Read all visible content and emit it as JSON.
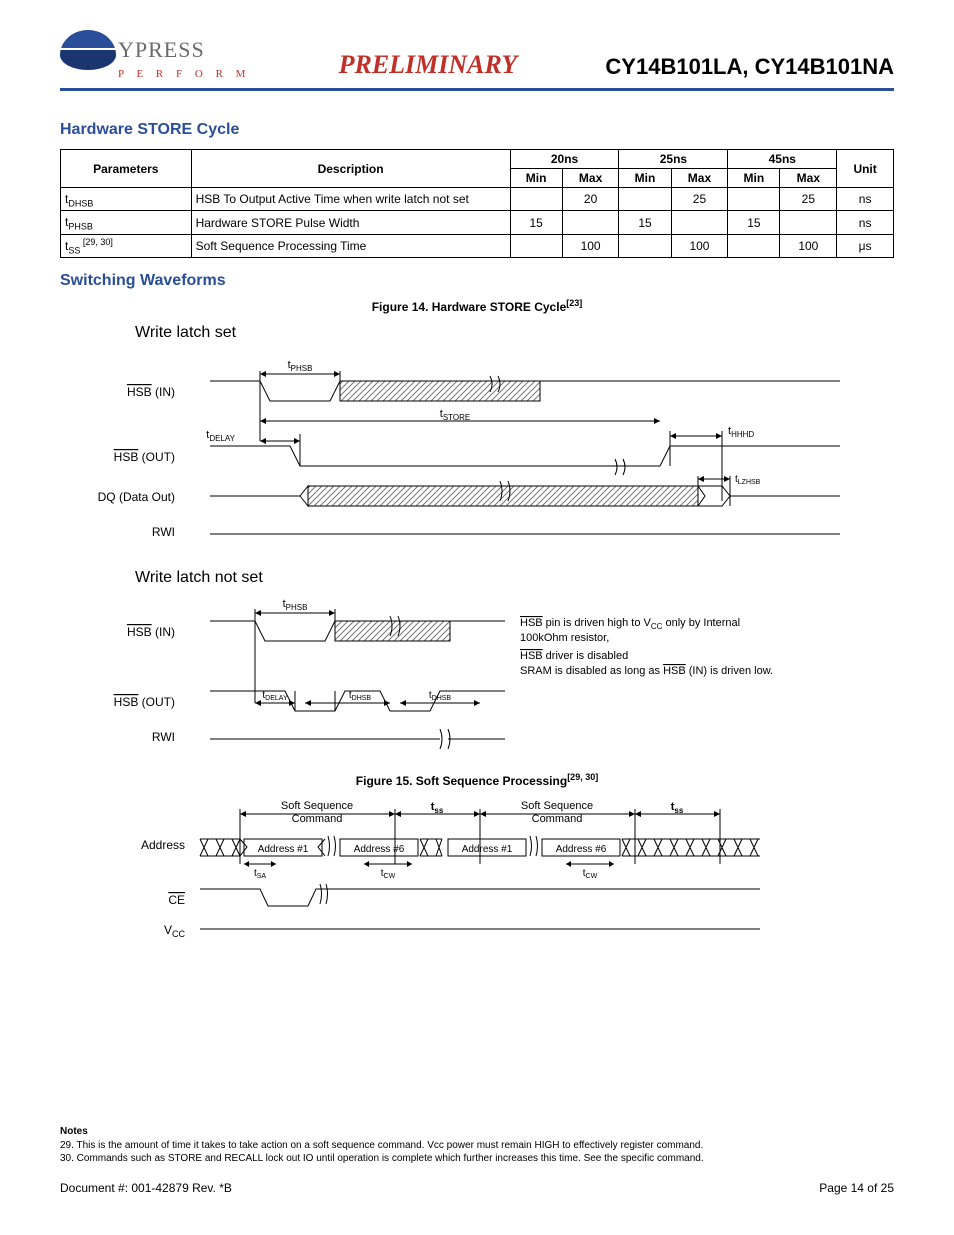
{
  "header": {
    "brand": "YPRESS",
    "tagline": "P E R F O R M",
    "preliminary": "PRELIMINARY",
    "parts": "CY14B101LA, CY14B101NA"
  },
  "section1_title": "Hardware STORE Cycle",
  "table": {
    "headers": {
      "parameters": "Parameters",
      "description": "Description",
      "cols": [
        "20ns",
        "25ns",
        "45ns"
      ],
      "min": "Min",
      "max": "Max",
      "unit": "Unit"
    },
    "rows": [
      {
        "param_main": "t",
        "param_sub": "DHSB",
        "param_sup": "",
        "desc": "HSB To Output Active Time when write latch not set",
        "c20min": "",
        "c20max": "20",
        "c25min": "",
        "c25max": "25",
        "c45min": "",
        "c45max": "25",
        "unit": "ns"
      },
      {
        "param_main": "t",
        "param_sub": "PHSB",
        "param_sup": "",
        "desc": "Hardware STORE Pulse Width",
        "c20min": "15",
        "c20max": "",
        "c25min": "15",
        "c25max": "",
        "c45min": "15",
        "c45max": "",
        "unit": "ns"
      },
      {
        "param_main": "t",
        "param_sub": "SS",
        "param_sup": " [29, 30]",
        "desc": "Soft Sequence Processing Time",
        "c20min": "",
        "c20max": "100",
        "c25min": "",
        "c25max": "100",
        "c45min": "",
        "c45max": "100",
        "unit": "μs"
      }
    ]
  },
  "section2_title": "Switching Waveforms",
  "fig14": {
    "caption_main": "Figure 14.  Hardware STORE Cycle",
    "caption_sup": "[23]",
    "title1": "Write latch set",
    "title2": "Write latch not set",
    "sig_hsb_in": "HSB",
    "sig_in_suffix": "  (IN)",
    "sig_hsb_out": "HSB",
    "sig_out_suffix": "  (OUT)",
    "sig_dq": "DQ (Data Out)",
    "sig_rwi": "RWI",
    "t_phsb": "PHSB",
    "t_store": "STORE",
    "t_delay": "DELAY",
    "t_hhhd": "HHHD",
    "t_lzhsb": "LZHSB",
    "t_dhsb": "DHSB",
    "note_l1a": "HSB",
    "note_l1b": " pin is driven high to V",
    "note_l1c": "CC",
    "note_l1d": " only by Internal",
    "note_l2": "100kOhm resistor,",
    "note_l3a": "HSB",
    "note_l3b": " driver is disabled",
    "note_l4a": "SRAM is disabled as long as ",
    "note_l4b": "HSB",
    "note_l4c": " (IN) is driven low."
  },
  "fig15": {
    "caption_main": "Figure 15.  Soft Sequence Processing",
    "caption_sup": "[29, 30]",
    "sig_address": "Address",
    "sig_ce": "CE",
    "sig_vcc_a": "V",
    "sig_vcc_b": "CC",
    "soft_seq": "Soft Sequence",
    "command": "Command",
    "t_ss": "ss",
    "t_sa": "SA",
    "t_cw": "CW",
    "addr1": "Address #1",
    "addr6": "Address #6"
  },
  "notes": {
    "heading": "Notes",
    "n29": "29. This is the amount of time it takes to take action on a soft sequence command. Vcc power must remain HIGH to effectively register command.",
    "n30": "30. Commands such as STORE and RECALL lock out IO until operation is complete which further increases this time. See the specific command."
  },
  "footer": {
    "docnum": "Document #: 001-42879  Rev. *B",
    "page": "Page 14 of 25"
  }
}
